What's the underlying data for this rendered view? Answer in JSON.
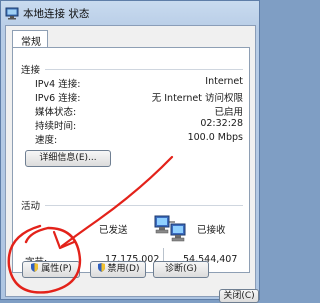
{
  "window": {
    "title": "本地连接 状态"
  },
  "tabs": [
    {
      "label": "常规"
    }
  ],
  "connection": {
    "heading": "连接",
    "rows": [
      {
        "label": "IPv4 连接:",
        "value": "Internet"
      },
      {
        "label": "IPv6 连接:",
        "value": "无 Internet 访问权限"
      },
      {
        "label": "媒体状态:",
        "value": "已启用"
      },
      {
        "label": "持续时间:",
        "value": "02:32:28"
      },
      {
        "label": "速度:",
        "value": "100.0 Mbps"
      }
    ],
    "details_button": "详细信息(E)..."
  },
  "activity": {
    "heading": "活动",
    "sent_label": "已发送",
    "received_label": "已接收",
    "bytes_label": "字节:",
    "bytes_sent": "17,175,002",
    "bytes_received": "54,544,407"
  },
  "buttons": {
    "properties": "属性(P)",
    "disable": "禁用(D)",
    "diagnose": "诊断(G)",
    "close": "关闭(C)"
  },
  "colors": {
    "annotation": "#e3221a"
  },
  "icons": [
    "network-status-icon",
    "network-computers-icon",
    "shield-icon"
  ]
}
